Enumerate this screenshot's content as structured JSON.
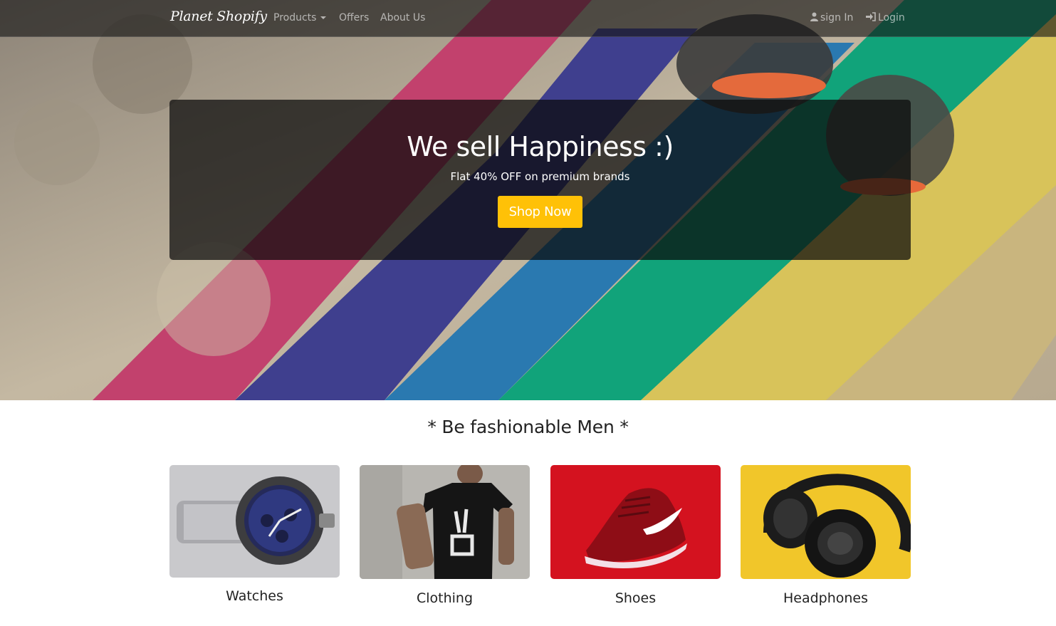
{
  "nav": {
    "brand": "Planet Shopify",
    "products_label": "Products",
    "offers_label": "Offers",
    "about_label": "About Us",
    "signin_label": "sign In",
    "login_label": "Login"
  },
  "hero": {
    "title": "We sell Happiness :)",
    "subtitle": "Flat 40% OFF on premium brands",
    "button_label": "Shop Now"
  },
  "section": {
    "title": "* Be fashionable Men *",
    "categories": [
      {
        "label": "Watches",
        "icon": "watch-image"
      },
      {
        "label": "Clothing",
        "icon": "tshirt-image"
      },
      {
        "label": "Shoes",
        "icon": "shoe-image"
      },
      {
        "label": "Headphones",
        "icon": "headphones-image"
      }
    ]
  },
  "colors": {
    "accent": "#ffc107",
    "navbar": "#141414"
  }
}
